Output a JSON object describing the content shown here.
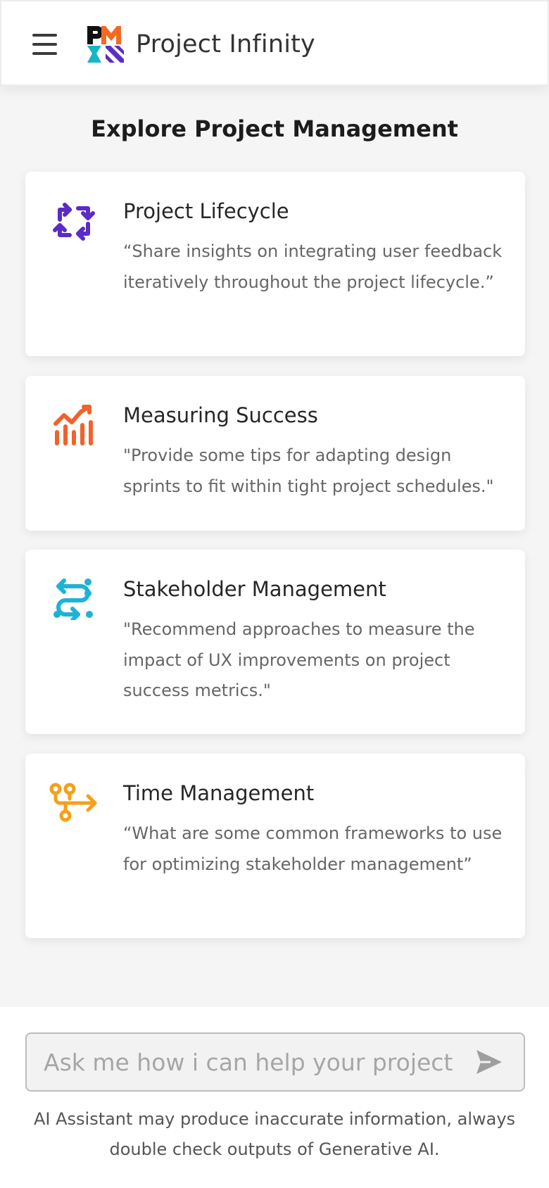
{
  "header": {
    "menu_icon": "hamburger-menu-icon",
    "logo_icon": "pmi-logo-icon",
    "title": "Project Infinity"
  },
  "main": {
    "title": "Explore Project Management",
    "cards": [
      {
        "title": "Project Lifecycle",
        "description": "“Share insights on integrating user feedback iteratively throughout the project lifecycle.”",
        "icon": "cycle-arrows-icon",
        "icon_color": "#5b2bc6"
      },
      {
        "title": "Measuring Success",
        "description": "\"Provide some tips for adapting design sprints to fit within tight project schedules.\"",
        "icon": "chart-trend-icon",
        "icon_color": "#f0622b"
      },
      {
        "title": "Stakeholder Management",
        "description": "\"Recommend approaches to measure the impact of UX improvements on project success metrics.\"",
        "icon": "path-connect-icon",
        "icon_color": "#1db3d6"
      },
      {
        "title": "Time Management",
        "description": "“What are some common frameworks to use for optimizing stakeholder management”",
        "icon": "workflow-nodes-icon",
        "icon_color": "#f5a018"
      }
    ]
  },
  "footer": {
    "input_placeholder": "Ask me how i can help your project",
    "send_icon": "send-arrow-icon",
    "disclaimer": "AI Assistant may produce inaccurate information, always double check outputs of Generative AI."
  },
  "colors": {
    "logo_orange": "#f26a21",
    "logo_teal": "#16b6c8",
    "logo_purple": "#5c2ec8",
    "logo_black": "#111111"
  }
}
